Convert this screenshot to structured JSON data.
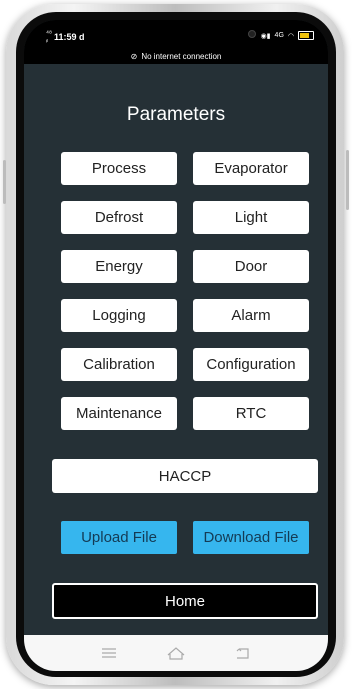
{
  "status_bar": {
    "time": "11:59",
    "time_suffix": "d",
    "network_label": "4G"
  },
  "network_banner": {
    "text": "No internet connection"
  },
  "page": {
    "title": "Parameters"
  },
  "parameter_buttons": [
    {
      "label": "Process"
    },
    {
      "label": "Evaporator"
    },
    {
      "label": "Defrost"
    },
    {
      "label": "Light"
    },
    {
      "label": "Energy"
    },
    {
      "label": "Door"
    },
    {
      "label": "Logging"
    },
    {
      "label": "Alarm"
    },
    {
      "label": "Calibration"
    },
    {
      "label": "Configuration"
    },
    {
      "label": "Maintenance"
    },
    {
      "label": "RTC"
    }
  ],
  "haccp_button": {
    "label": "HACCP"
  },
  "file_buttons": {
    "upload": "Upload File",
    "download": "Download File"
  },
  "home_button": {
    "label": "Home"
  },
  "colors": {
    "background": "#253036",
    "accent_blue": "#36b6ee",
    "button_white": "#ffffff"
  },
  "nav_icons": [
    "menu-icon",
    "home-icon",
    "back-icon"
  ]
}
